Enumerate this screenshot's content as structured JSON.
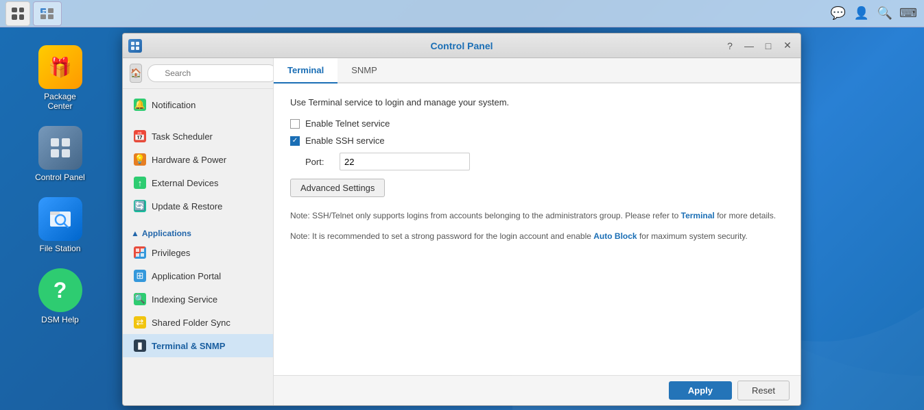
{
  "taskbar": {
    "apps": [
      {
        "name": "app-grid",
        "label": "App Grid"
      },
      {
        "name": "control-panel-taskbar",
        "label": "Control Panel"
      }
    ],
    "right_icons": [
      "chat-icon",
      "user-icon",
      "search-icon",
      "keyboard-icon"
    ]
  },
  "desktop": {
    "icons": [
      {
        "id": "package-center",
        "label": "Package\nCenter",
        "emoji": "🎁"
      },
      {
        "id": "control-panel",
        "label": "Control Panel",
        "emoji": "🔧"
      },
      {
        "id": "file-station",
        "label": "File Station",
        "emoji": "🔍"
      },
      {
        "id": "dsm-help",
        "label": "DSM Help",
        "emoji": "?"
      }
    ]
  },
  "window": {
    "title": "Control Panel",
    "controls": [
      "help",
      "minimize",
      "maximize",
      "close"
    ],
    "sidebar": {
      "search_placeholder": "Search",
      "sections": [
        {
          "header": null,
          "items": [
            {
              "id": "notification",
              "label": "Notification",
              "icon": "bell",
              "color": "green"
            }
          ]
        },
        {
          "header": null,
          "items": [
            {
              "id": "task-scheduler",
              "label": "Task Scheduler",
              "icon": "calendar",
              "color": "red"
            },
            {
              "id": "hardware-power",
              "label": "Hardware & Power",
              "icon": "bulb",
              "color": "orange"
            },
            {
              "id": "external-devices",
              "label": "External Devices",
              "icon": "usb",
              "color": "green"
            },
            {
              "id": "update-restore",
              "label": "Update & Restore",
              "icon": "refresh",
              "color": "teal"
            }
          ]
        },
        {
          "header": "Applications",
          "items": [
            {
              "id": "privileges",
              "label": "Privileges",
              "icon": "grid",
              "color": "multi"
            },
            {
              "id": "application-portal",
              "label": "Application Portal",
              "icon": "portal",
              "color": "blue"
            },
            {
              "id": "indexing-service",
              "label": "Indexing Service",
              "icon": "index",
              "color": "green"
            },
            {
              "id": "shared-folder-sync",
              "label": "Shared Folder Sync",
              "icon": "sync",
              "color": "yellow"
            },
            {
              "id": "terminal-snmp",
              "label": "Terminal & SNMP",
              "icon": "terminal",
              "color": "dark",
              "active": true
            }
          ]
        }
      ]
    },
    "tabs": [
      {
        "id": "terminal",
        "label": "Terminal",
        "active": true
      },
      {
        "id": "snmp",
        "label": "SNMP",
        "active": false
      }
    ],
    "content": {
      "description": "Use Terminal service to login and manage your system.",
      "telnet_label": "Enable Telnet service",
      "telnet_checked": false,
      "ssh_label": "Enable SSH service",
      "ssh_checked": true,
      "port_label": "Port:",
      "port_value": "22",
      "advanced_btn": "Advanced Settings",
      "note1_prefix": "Note: SSH/Telnet only supports logins from accounts belonging to the administrators group. Please refer to ",
      "note1_link": "Terminal",
      "note1_suffix": " for more details.",
      "note2_prefix": "Note: It is recommended to set a strong password for the login account and enable ",
      "note2_link": "Auto Block",
      "note2_suffix": " for maximum system security."
    },
    "footer": {
      "apply_label": "Apply",
      "reset_label": "Reset"
    }
  }
}
